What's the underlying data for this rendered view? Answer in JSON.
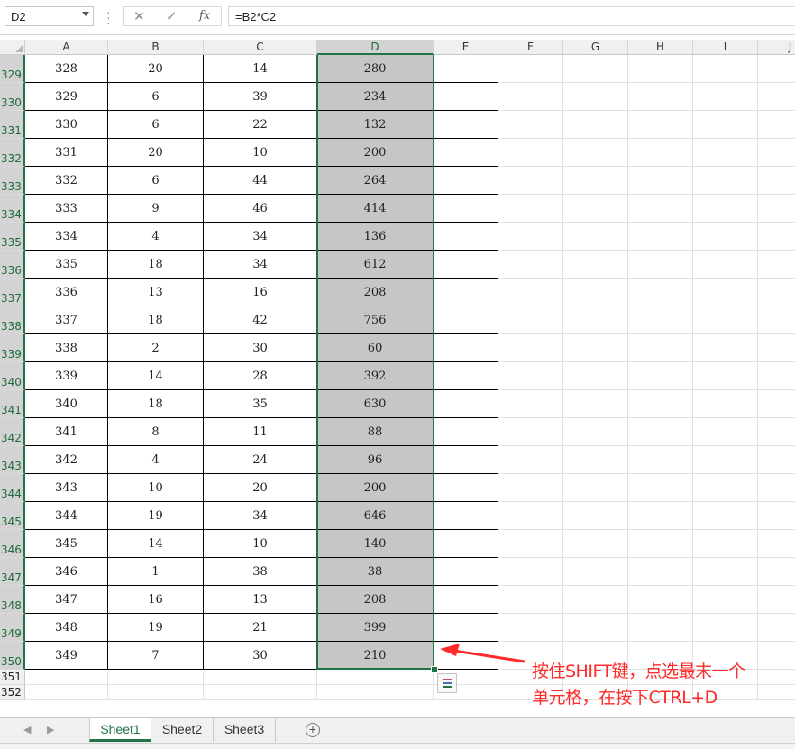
{
  "formula_bar": {
    "name_box": "D2",
    "cancel_icon": "cancel-icon",
    "enter_icon": "check-icon",
    "function_label": "fx",
    "formula": "=B2*C2"
  },
  "columns": [
    "A",
    "B",
    "C",
    "D",
    "E",
    "F",
    "G",
    "H",
    "I",
    "J"
  ],
  "selected_column": "D",
  "rows": [
    {
      "row": "329",
      "a": "328",
      "b": "20",
      "c": "14",
      "d": "280"
    },
    {
      "row": "330",
      "a": "329",
      "b": "6",
      "c": "39",
      "d": "234"
    },
    {
      "row": "331",
      "a": "330",
      "b": "6",
      "c": "22",
      "d": "132"
    },
    {
      "row": "332",
      "a": "331",
      "b": "20",
      "c": "10",
      "d": "200"
    },
    {
      "row": "333",
      "a": "332",
      "b": "6",
      "c": "44",
      "d": "264"
    },
    {
      "row": "334",
      "a": "333",
      "b": "9",
      "c": "46",
      "d": "414"
    },
    {
      "row": "335",
      "a": "334",
      "b": "4",
      "c": "34",
      "d": "136"
    },
    {
      "row": "336",
      "a": "335",
      "b": "18",
      "c": "34",
      "d": "612"
    },
    {
      "row": "337",
      "a": "336",
      "b": "13",
      "c": "16",
      "d": "208"
    },
    {
      "row": "338",
      "a": "337",
      "b": "18",
      "c": "42",
      "d": "756"
    },
    {
      "row": "339",
      "a": "338",
      "b": "2",
      "c": "30",
      "d": "60"
    },
    {
      "row": "340",
      "a": "339",
      "b": "14",
      "c": "28",
      "d": "392"
    },
    {
      "row": "341",
      "a": "340",
      "b": "18",
      "c": "35",
      "d": "630"
    },
    {
      "row": "342",
      "a": "341",
      "b": "8",
      "c": "11",
      "d": "88"
    },
    {
      "row": "343",
      "a": "342",
      "b": "4",
      "c": "24",
      "d": "96"
    },
    {
      "row": "344",
      "a": "343",
      "b": "10",
      "c": "20",
      "d": "200"
    },
    {
      "row": "345",
      "a": "344",
      "b": "19",
      "c": "34",
      "d": "646"
    },
    {
      "row": "346",
      "a": "345",
      "b": "14",
      "c": "10",
      "d": "140"
    },
    {
      "row": "347",
      "a": "346",
      "b": "1",
      "c": "38",
      "d": "38"
    },
    {
      "row": "348",
      "a": "347",
      "b": "16",
      "c": "13",
      "d": "208"
    },
    {
      "row": "349",
      "a": "348",
      "b": "19",
      "c": "21",
      "d": "399"
    },
    {
      "row": "350",
      "a": "349",
      "b": "7",
      "c": "30",
      "d": "210"
    }
  ],
  "empty_rows": [
    "351",
    "352"
  ],
  "annotation": {
    "line1": "按住SHIFT键，点选最末一个",
    "line2": "单元格，在按下CTRL+D",
    "color": "#ff2a2a"
  },
  "sheets": [
    "Sheet1",
    "Sheet2",
    "Sheet3"
  ],
  "active_sheet": "Sheet1",
  "colors": {
    "accent": "#217346",
    "selection_fill": "#c6c6c6"
  }
}
